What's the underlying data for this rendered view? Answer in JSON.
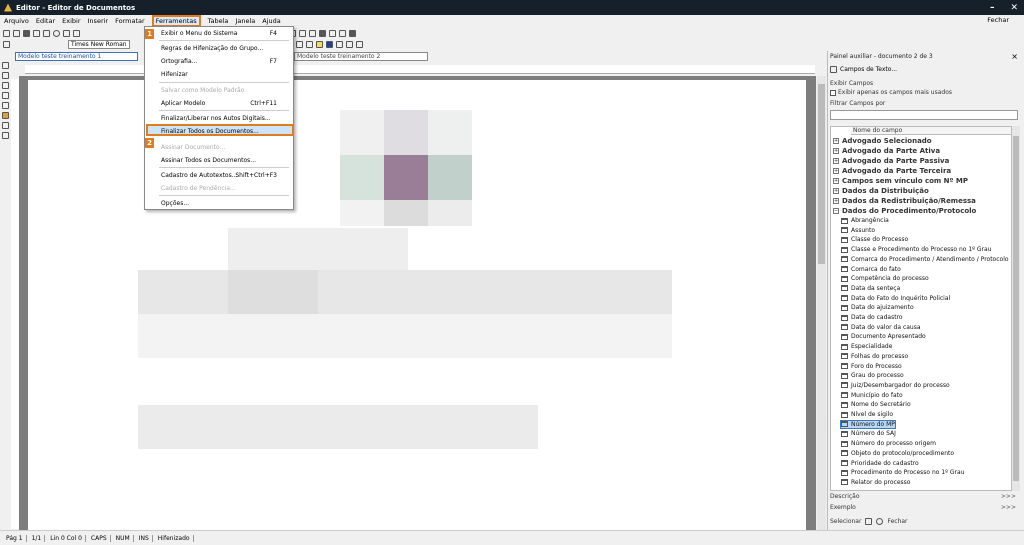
{
  "window": {
    "title": "Editor - Editor de Documentos"
  },
  "menubar": {
    "items": [
      "Arquivo",
      "Editar",
      "Exibir",
      "Inserir",
      "Formatar",
      "Ferramentas",
      "Tabela",
      "Janela",
      "Ajuda"
    ],
    "close_label": "Fechar"
  },
  "toolbar": {
    "font_name": "Times New Roman"
  },
  "documents": {
    "active_tab": "Modelo teste treinamento 1",
    "second_tab": "Modelo teste treinamento 2"
  },
  "tools_menu": {
    "items": [
      {
        "label": "Exibir o Menu do Sistema",
        "shortcut": "F4",
        "disabled": false
      },
      {
        "label": "Regras de Hifenização do Grupo...",
        "shortcut": "",
        "disabled": false
      },
      {
        "label": "Ortografia...",
        "shortcut": "F7",
        "disabled": false
      },
      {
        "label": "Hifenizar",
        "shortcut": "",
        "disabled": false
      },
      {
        "label": "Salvar como Modelo Padrão",
        "shortcut": "",
        "disabled": true
      },
      {
        "label": "Aplicar Modelo",
        "shortcut": "Ctrl+F11",
        "disabled": false
      },
      {
        "label": "Finalizar/Liberar nos Autos Digitais...",
        "shortcut": "",
        "disabled": false
      },
      {
        "label": "Finalizar Todos os Documentos...",
        "shortcut": "",
        "disabled": false
      },
      {
        "label": "Assinar Documento...",
        "shortcut": "",
        "disabled": true
      },
      {
        "label": "Assinar Todos os Documentos...",
        "shortcut": "",
        "disabled": false
      },
      {
        "label": "Cadastro de Autotextos...",
        "shortcut": "Shift+Ctrl+F3",
        "disabled": false
      },
      {
        "label": "Cadastro de Pendência...",
        "shortcut": "",
        "disabled": true
      },
      {
        "label": "Opções...",
        "shortcut": "",
        "disabled": false
      }
    ]
  },
  "badges": {
    "step1": "1",
    "step2": "2"
  },
  "side_panel": {
    "title": "Painel auxiliar - documento 2 de 3",
    "close": "×",
    "fields_button": "Campos de Texto...",
    "show_fields": "Exibir Campos",
    "only_used": "Exibir apenas os campos mais usados",
    "filter_label": "Filtrar Campos por",
    "column_header": "Nome do campo",
    "groups": [
      {
        "label": "Advogado Selecionado",
        "expanded": false
      },
      {
        "label": "Advogado da Parte Ativa",
        "expanded": false
      },
      {
        "label": "Advogado da Parte Passiva",
        "expanded": false
      },
      {
        "label": "Advogado da Parte Terceira",
        "expanded": false
      },
      {
        "label": "Campos sem vínculo com Nº MP",
        "expanded": false
      },
      {
        "label": "Dados da Distribuição",
        "expanded": false
      },
      {
        "label": "Dados da Redistribuição/Remessa",
        "expanded": false
      },
      {
        "label": "Dados do Procedimento/Protocolo",
        "expanded": true
      }
    ],
    "fields": [
      "Abrangência",
      "Assunto",
      "Classe do Processo",
      "Classe e Procedimento do Processo no 1º Grau",
      "Comarca do Procedimento / Atendimento / Protocolo",
      "Comarca do fato",
      "Competência do processo",
      "Data da senteça",
      "Data do Fato do Inquérito Policial",
      "Data do ajuizamento",
      "Data do cadastro",
      "Data do valor da causa",
      "Documento Apresentado",
      "Especialidade",
      "Folhas do processo",
      "Foro do Processo",
      "Grau do processo",
      "Juiz/Desembargador do processo",
      "Município do fato",
      "Nome do Secretário",
      "Nível de sigilo",
      "Número do MP",
      "Número do SAJ",
      "Número do processo origem",
      "Objeto do protocolo/procedimento",
      "Prioridade do cadastro",
      "Procedimento do Processo no 1º Grau",
      "Relator do processo"
    ],
    "selected_field": "Número do MP",
    "description_label": "Descrição",
    "example_label": "Exemplo",
    "more": ">>>",
    "select_label": "Selecionar",
    "close_label": "Fechar"
  },
  "statusbar": {
    "page": "Pág 1",
    "pages": "1/1",
    "position": "Lin 0 Col 0",
    "caps": "CAPS",
    "num": "NUM",
    "ins": "INS",
    "hyph": "Hifenizado"
  },
  "colors": {
    "highlight_border": "#e07b1e",
    "title_bg": "#15202b",
    "selection": "#b9d7f3"
  }
}
